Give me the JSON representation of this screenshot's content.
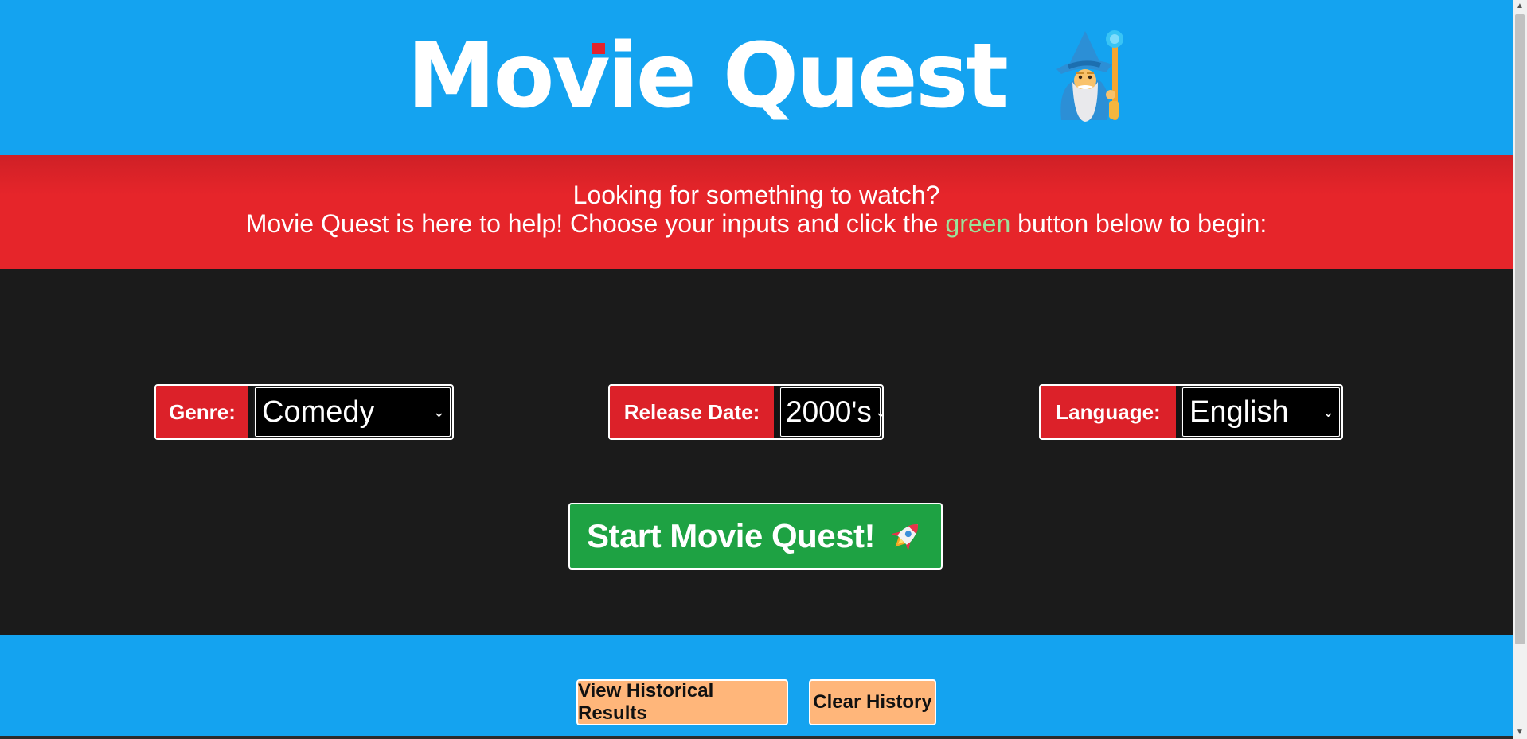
{
  "header": {
    "title": "Movie Quest",
    "mascot_icon": "wizard-icon"
  },
  "banner": {
    "line1": "Looking for something to watch?",
    "line2_before": "Movie Quest is here to help! Choose your inputs and click the ",
    "line2_green": "green",
    "line2_after": " button below to begin:"
  },
  "filters": {
    "genre": {
      "label": "Genre:",
      "value": "Comedy"
    },
    "release": {
      "label": "Release Date:",
      "value": "2000's"
    },
    "language": {
      "label": "Language:",
      "value": "English"
    }
  },
  "start_button": {
    "label": "Start Movie Quest!",
    "icon": "rocket-icon"
  },
  "footer": {
    "history_label": "View Historical Results",
    "clear_label": "Clear History"
  },
  "colors": {
    "header_blue": "#14a3f0",
    "banner_red": "#e6252a",
    "start_green": "#1ea243",
    "footer_button": "#ffb67a",
    "highlight_green": "#9be29a"
  }
}
